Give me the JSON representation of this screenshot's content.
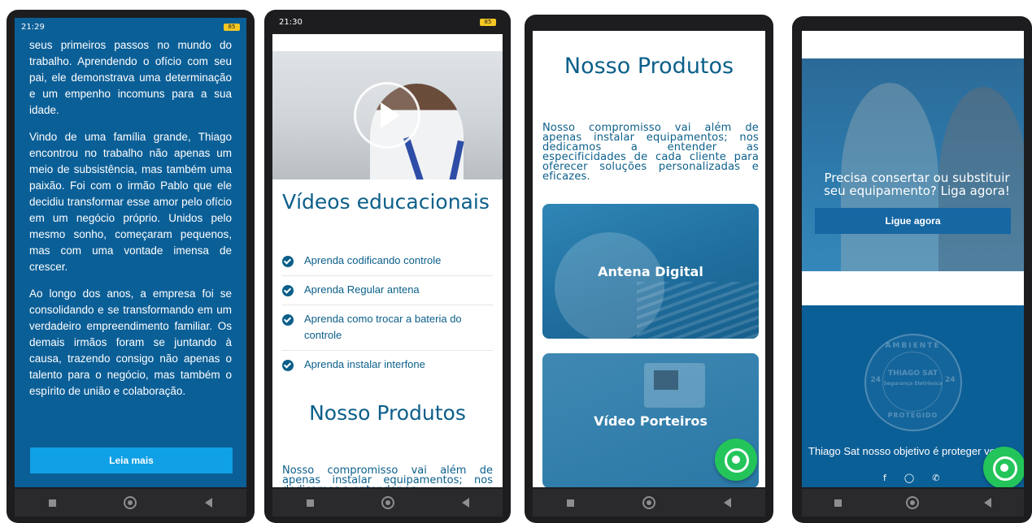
{
  "phone1": {
    "status": {
      "time": "21:29",
      "right": "85"
    },
    "paragraphs": [
      "seus primeiros passos no mundo do trabalho. Aprendendo o ofício com seu pai, ele demonstrava uma determinação e um empenho incomuns para a sua idade.",
      "Vindo de uma família grande, Thiago encontrou no trabalho não apenas um meio de subsistência, mas também uma paixão. Foi com o irmão Pablo que ele decidiu transformar esse amor pelo ofício em um negócio próprio. Unidos pelo mesmo sonho, começaram pequenos, mas com uma vontade imensa de crescer.",
      "Ao longo dos anos, a empresa foi se consolidando e se transformando em um verdadeiro empreendimento familiar. Os demais irmãos foram se juntando à causa, trazendo consigo não apenas o talento para o negócio, mas também o espírito de união e colaboração."
    ],
    "button": "Leia mais"
  },
  "phone2": {
    "status": {
      "time": "21:30",
      "right": "85"
    },
    "heading": "Vídeos educacionais",
    "videos": [
      "Aprenda codificando controle",
      "Aprenda Regular antena",
      "Aprenda como trocar a bateria do controle",
      "Aprenda instalar interfone"
    ],
    "products_title": "Nosso Produtos",
    "products_text": "Nosso compromisso vai além de apenas instalar equipamentos; nos dedicamos a entender as"
  },
  "phone3": {
    "products_title": "Nosso Produtos",
    "products_text": "Nosso compromisso vai além de apenas instalar equipamentos; nos dedicamos a entender as especificidades de cada cliente para oferecer soluções personalizadas e eficazes.",
    "cards": [
      "Antena Digital",
      "Vídeo Porteiros"
    ]
  },
  "phone4": {
    "hero_text": "Precisa consertar ou substituir seu equipamento? Liga agora!",
    "hero_button": "Ligue agora",
    "logo": {
      "top": "AMBIENTE",
      "brand": "THIAGO SAT",
      "mid": "Segurança Eletrônica",
      "hours": "24",
      "bottom": "PROTEGIDO"
    },
    "footer_text": "Thiago Sat nosso objetivo é proteger você!"
  },
  "colors": {
    "brand_blue": "#0b5f97",
    "accent_blue": "#10a0e6",
    "whatsapp": "#23c55a"
  },
  "icons": [
    "play-icon",
    "check-circle-icon",
    "whatsapp-icon",
    "facebook-icon",
    "instagram-icon",
    "whatsapp-small-icon"
  ]
}
